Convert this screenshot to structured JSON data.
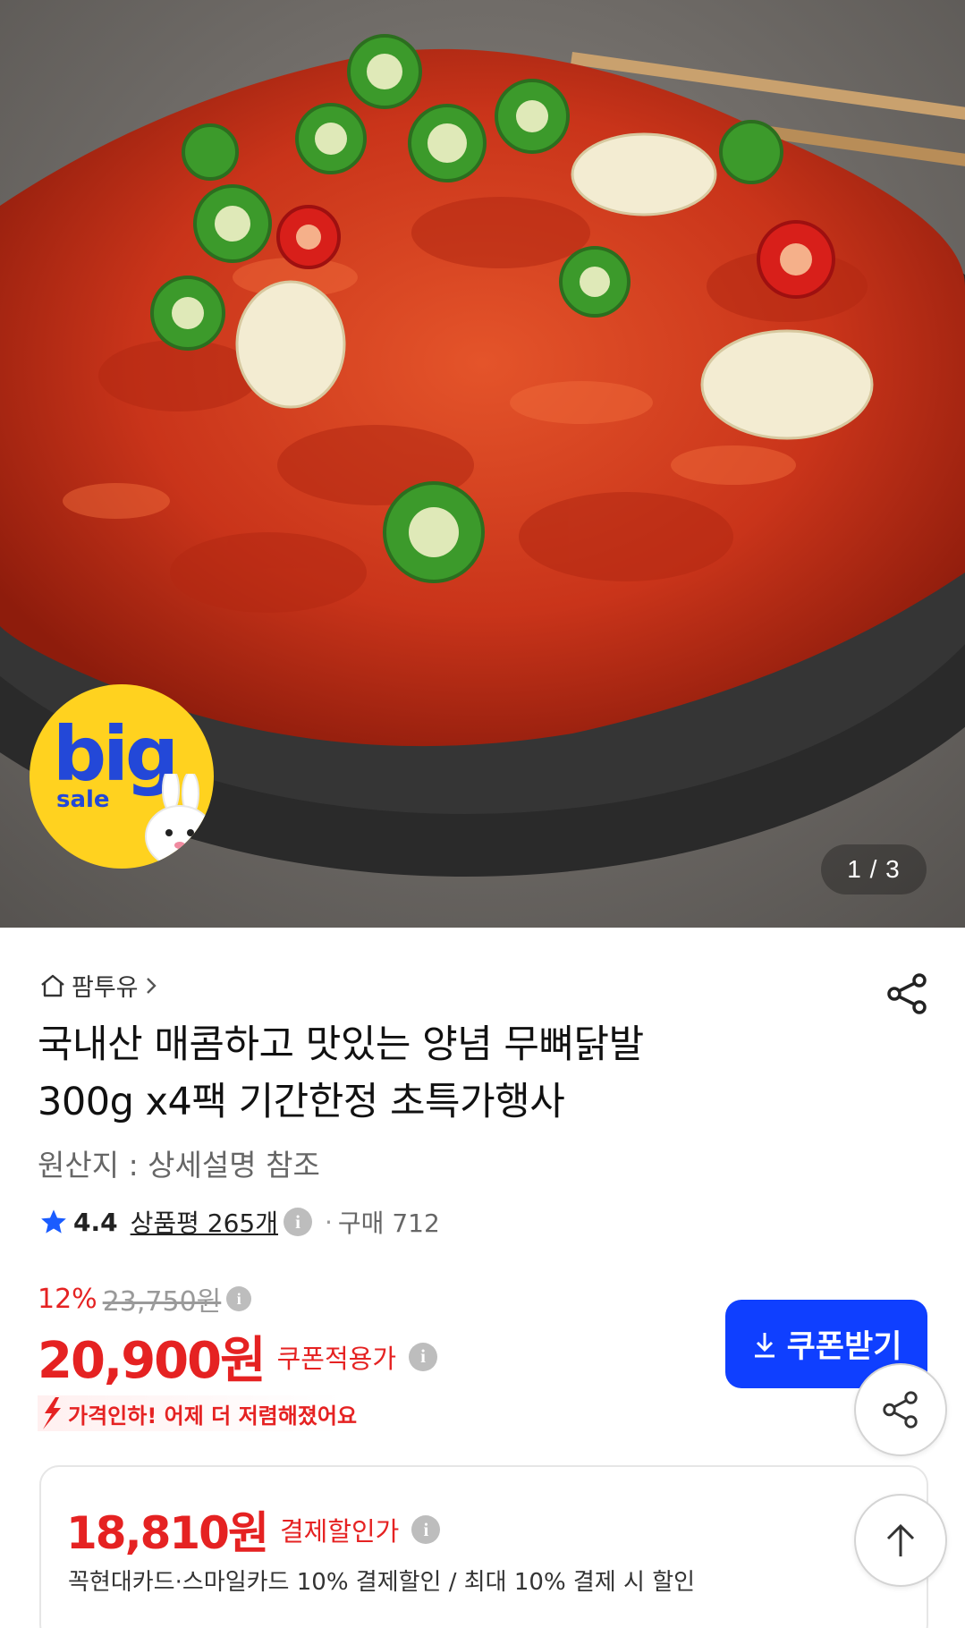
{
  "hero": {
    "image_alt": "",
    "badge": {
      "big": "big",
      "sale": "sale"
    },
    "pager": "1 / 3"
  },
  "store": {
    "name": "팜투유"
  },
  "product": {
    "title_line1": "국내산 매콤하고 맛있는 양념 무뼈닭발",
    "title_line2": "300g x4팩 기간한정 초특가행사",
    "origin": "원산지 : 상세설명 참조"
  },
  "rating": {
    "score": "4.4",
    "reviews": "상품평 265개",
    "separator": "·",
    "purchase": "구매 712"
  },
  "pricing": {
    "discount_pct": "12%",
    "original_price": "23,750원",
    "price": "20,900원",
    "price_label": "쿠폰적용가",
    "coupon_button": "쿠폰받기",
    "drop_note": "가격인하! 어제 더 저렴해졌어요"
  },
  "payment": {
    "price": "18,810원",
    "label": "결제할인가",
    "detail": "꼭현대카드·스마일카드 10% 결제할인 / 최대 10% 결제 시 할인"
  },
  "colors": {
    "accent_red": "#e52222",
    "coupon_blue": "#0f3fff",
    "star_blue": "#1a5cff",
    "badge_yellow": "#ffd21f"
  },
  "icons": {
    "store": "home-icon",
    "share": "share-icon",
    "star": "star-icon",
    "info": "info-icon",
    "download": "download-icon",
    "scroll_top": "arrow-up-icon",
    "price_drop": "down-arrow-icon"
  }
}
